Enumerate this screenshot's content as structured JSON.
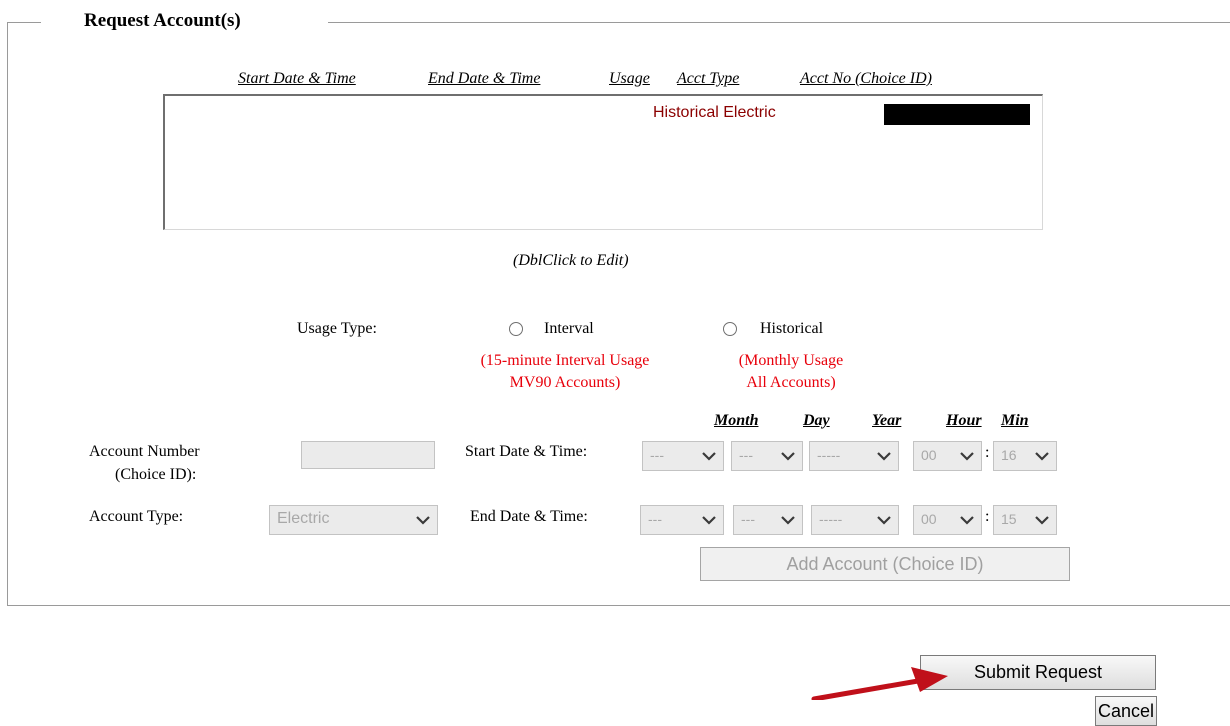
{
  "fieldset": {
    "legend": "Request Account(s)"
  },
  "list": {
    "columns": [
      "Start Date & Time",
      "End Date & Time",
      "Usage",
      "Acct Type",
      "Acct No (Choice ID)"
    ],
    "rows": [
      {
        "text": "Historical  Electric"
      }
    ],
    "hint": "(DblClick to Edit)"
  },
  "usage_type": {
    "label": "Usage Type:",
    "options": [
      {
        "label": "Interval",
        "desc1": "(15-minute Interval Usage",
        "desc2": "MV90 Accounts)"
      },
      {
        "label": "Historical",
        "desc1": "(Monthly Usage",
        "desc2": "All Accounts)"
      }
    ]
  },
  "form": {
    "account_number_label1": "Account Number",
    "account_number_label2": "(Choice ID):",
    "account_type_label": "Account Type:",
    "account_type_value": "Electric",
    "start_label": "Start Date & Time:",
    "end_label": "End Date & Time:",
    "date_headers": {
      "month": "Month",
      "day": "Day",
      "year": "Year",
      "hour": "Hour",
      "min": "Min"
    },
    "start": {
      "month": "---",
      "day": "---",
      "year": "-----",
      "hour": "00",
      "min": "16"
    },
    "end": {
      "month": "---",
      "day": "---",
      "year": "-----",
      "hour": "00",
      "min": "15"
    },
    "colon": ":"
  },
  "buttons": {
    "add_account": "Add Account (Choice ID)",
    "submit": "Submit Request",
    "cancel": "Cancel"
  },
  "colors": {
    "accent_red": "#e8000b",
    "list_text": "#8b0000",
    "annotation_arrow": "#c0101a"
  }
}
